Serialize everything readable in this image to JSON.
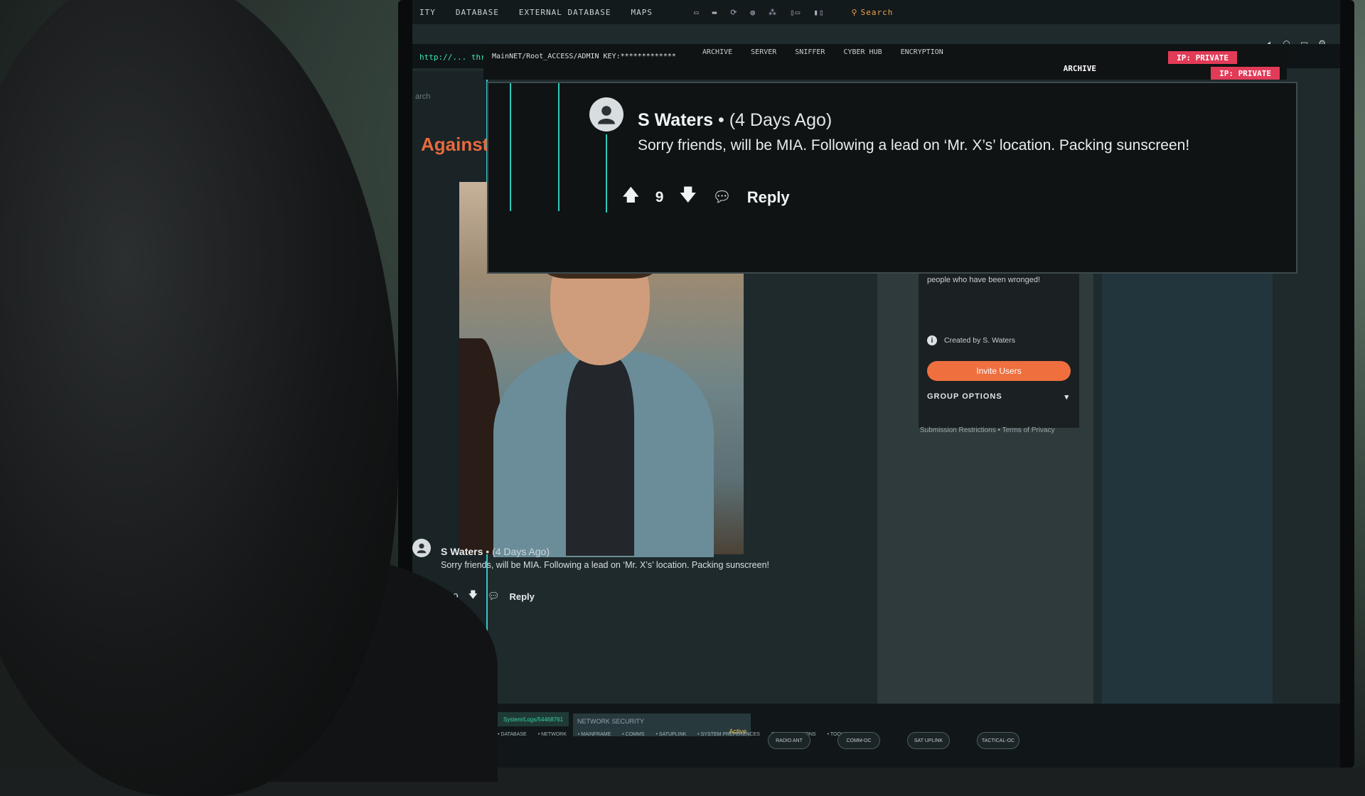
{
  "topbar": {
    "menu": [
      "ITY",
      "DATABASE",
      "EXTERNAL DATABASE",
      "MAPS"
    ],
    "search": "Search"
  },
  "url": "http://... thr",
  "overlay_header": {
    "admin_key": "MainNET/Root_ACCESS/ADMIN KEY:*************",
    "tabs": [
      "ARCHIVE",
      "SERVER",
      "SNIFFER",
      "CYBER HUB",
      "ENCRYPTION"
    ],
    "archive2": "ARCHIVE",
    "ip1": "IP: PRIVATE",
    "ip2": "IP: PRIVATE"
  },
  "overlay_post": {
    "author": "S Waters",
    "time": "• (4 Days Ago)",
    "body": "Sorry friends, will be MIA. Following a lead on ‘Mr. X’s’ location. Packing sunscreen!",
    "votes": "9",
    "reply": "Reply"
  },
  "left": {
    "search_label": "arch",
    "heading": "Against"
  },
  "post": {
    "author": "S Waters",
    "time": "• (4 Days Ago)",
    "body": "Sorry friends, will be MIA. Following a lead on ‘Mr. X’s’ location. Packing sunscreen!",
    "votes": "9",
    "reply": "Reply"
  },
  "group": {
    "description": "This community is a private group of people who have been wronged!",
    "created_by": "Created by S. Waters",
    "invite_label": "Invite Users",
    "options_label": "GROUP OPTIONS",
    "footer": "Submission Restrictions • Terms of Privacy"
  },
  "bottom": {
    "log_path": "System/Logs/54468761",
    "network_security": "NETWORK SECURITY",
    "active": "Active",
    "tabs": [
      "• DATABASE",
      "• NETWORK",
      "• MAINFRAME",
      "• COMMS",
      "• SATUPLINK",
      "• SYSTEM PREFERENCES",
      "SCREEN OPTIONS",
      "• TOOLS"
    ],
    "round_buttons": [
      "RADIO ANT",
      "COMM-OC",
      "SAT UPLINK",
      "TACTICAL-OC"
    ]
  },
  "colors": {
    "accent_orange": "#ef6f3f",
    "accent_teal": "#2ec9b8",
    "ip_red": "#e23b58"
  }
}
